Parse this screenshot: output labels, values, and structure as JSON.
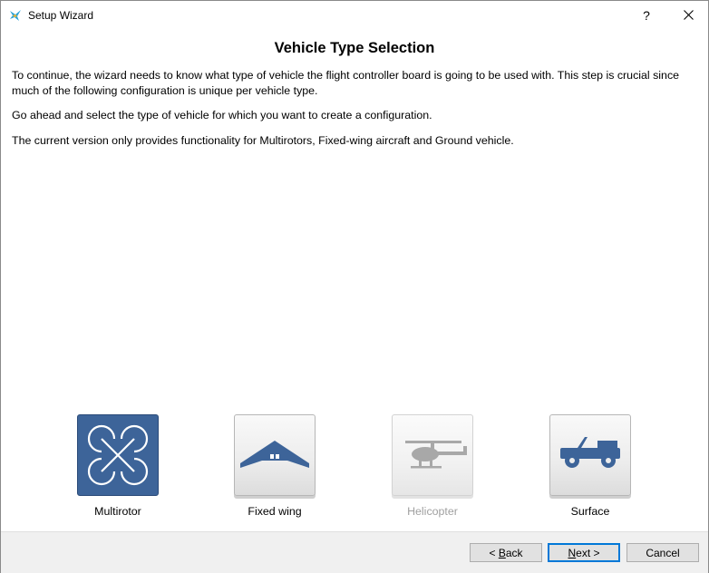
{
  "window": {
    "title": "Setup Wizard",
    "help_label": "?",
    "close_label": "✕",
    "icon": "app-logo-icon"
  },
  "page": {
    "heading": "Vehicle Type Selection",
    "paragraphs": [
      "To continue, the wizard needs to know what type of vehicle the flight controller board is going to be used with. This step is crucial since much of the following configuration is unique per vehicle type.",
      "Go ahead and select the type of vehicle for which you want to create a configuration.",
      "The current version only provides functionality for Multirotors, Fixed-wing aircraft and Ground vehicle."
    ]
  },
  "vehicles": [
    {
      "label": "Multirotor",
      "icon": "multirotor-icon",
      "state": "selected"
    },
    {
      "label": "Fixed wing",
      "icon": "fixed-wing-icon",
      "state": "normal"
    },
    {
      "label": "Helicopter",
      "icon": "helicopter-icon",
      "state": "disabled"
    },
    {
      "label": "Surface",
      "icon": "surface-vehicle-icon",
      "state": "normal"
    }
  ],
  "footer": {
    "back_prefix": "< ",
    "back_mnemonic": "B",
    "back_rest": "ack",
    "next_mnemonic": "N",
    "next_rest": "ext >",
    "cancel_label": "Cancel"
  },
  "colors": {
    "selected_tile": "#3d6499",
    "icon_blue": "#3d6499",
    "disabled_icon": "#a8a8a8",
    "default_button_border": "#0078d7"
  }
}
